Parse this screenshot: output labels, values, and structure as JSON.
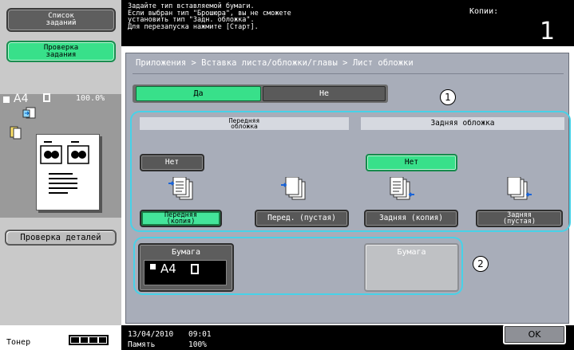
{
  "sidebar": {
    "job_list_label": "Список\nзаданий",
    "check_job_label": "Проверка\nзадания",
    "paper_size": "A4",
    "zoom": "100.0%",
    "check_details_label": "Проверка деталей",
    "toner_label": "Тонер"
  },
  "message": {
    "text": "Задайте тип вставляемой бумаги.\nЕсли выбран тип \"Брошюра\", вы не сможете\nустановить тип \"Задн. обложка\".\nДля перезапуска нажмите [Старт].",
    "copies_label": "Копии:",
    "copies_value": "1"
  },
  "breadcrumb": "Приложения > Вставка листа/обложки/главы > Лист обложки",
  "toggle": {
    "yes": "Да",
    "no": "Не"
  },
  "front_cover": {
    "header": "Передняя\nобложка",
    "none_label": "Нет",
    "copy_label": "Передняя\n(копия)",
    "blank_label": "Перед. (пустая)",
    "paper_label": "Бумага",
    "paper_value": "A4"
  },
  "back_cover": {
    "header": "Задняя обложка",
    "none_label": "Нет",
    "copy_label": "Задняя (копия)",
    "blank_label": "Задняя\n(пустая)",
    "paper_label": "Бумага"
  },
  "callouts": {
    "one": "1",
    "two": "2"
  },
  "footer": {
    "date": "13/04/2010",
    "time": "09:01",
    "memory_label": "Память",
    "memory_value": "100%",
    "ok_label": "OK"
  },
  "colors": {
    "accent_green": "#38e08a",
    "callout_cyan": "#47d2e8",
    "panel_bg": "#a8adb9"
  }
}
